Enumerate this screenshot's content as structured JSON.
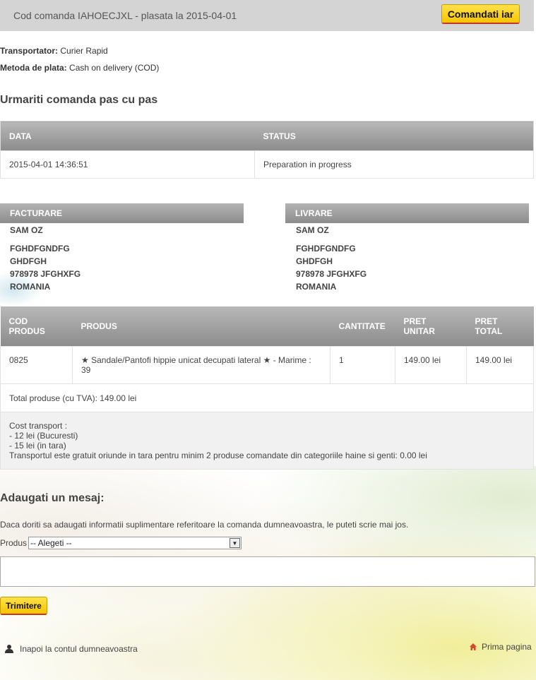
{
  "header": {
    "title": "Cod comanda IAHOECJXL - plasata la 2015-04-01",
    "reorder_label": "Comandati iar"
  },
  "order_info": {
    "carrier_label": "Transportator:",
    "carrier_value": "Curier Rapid",
    "payment_label": "Metoda de plata:",
    "payment_value": "Cash on delivery (COD)"
  },
  "tracking": {
    "title": "Urmariti comanda pas cu pas",
    "columns": [
      "DATA",
      "STATUS"
    ],
    "rows": [
      {
        "date": "2015-04-01 14:36:51",
        "status": "Preparation in progress"
      }
    ]
  },
  "billing": {
    "heading": "FACTURARE",
    "name": "SAM OZ",
    "line1": "FGHDFGNDFG",
    "line2": "GHDFGH",
    "line3": "978978 JFGHXFG",
    "country": "ROMANIA"
  },
  "shipping": {
    "heading": "LIVRARE",
    "name": "SAM OZ",
    "line1": "FGHDFGNDFG",
    "line2": "GHDFGH",
    "line3": "978978 JFGHXFG",
    "country": "ROMANIA"
  },
  "products": {
    "columns": {
      "code_l1": "COD",
      "code_l2": "PRODUS",
      "product": "PRODUS",
      "qty": "CANTITATE",
      "unit_l1": "PRET",
      "unit_l2": "UNITAR",
      "total_l1": "PRET",
      "total_l2": "TOTAL"
    },
    "rows": [
      {
        "code": "0825",
        "name": "★ Sandale/Pantofi hippie unicat decupati lateral ★ - Marime : 39",
        "qty": "1",
        "unit_price": "149.00 lei",
        "total_price": "149.00 lei"
      }
    ],
    "total_text": "Total produse (cu TVA): 149.00 lei",
    "transport": {
      "l1": "Cost transport :",
      "l2": "- 12 lei (Bucuresti)",
      "l3": "- 15 lei (in tara)",
      "l4": "Transportul este gratuit oriunde in tara pentru minim 2 produse comandate din categoriile haine si genti: 0.00 lei"
    }
  },
  "message": {
    "title": "Adaugati un mesaj:",
    "description": "Daca doriti sa adaugati informatii suplimentare referitoare la comanda dumneavoastra, le puteti scrie mai jos.",
    "product_label": "Produs",
    "select_value": "-- Alegeti --",
    "send_label": "Trimitere"
  },
  "footer": {
    "back_label": "Inapoi la contul dumneavoastra",
    "home_label": "Prima pagina"
  },
  "colors": {
    "button_yellow": "#f6c400",
    "header_gray": "#d4d4d4",
    "home_icon": "#d9472b"
  },
  "icons": {
    "back": "user-icon",
    "home": "home-icon"
  }
}
